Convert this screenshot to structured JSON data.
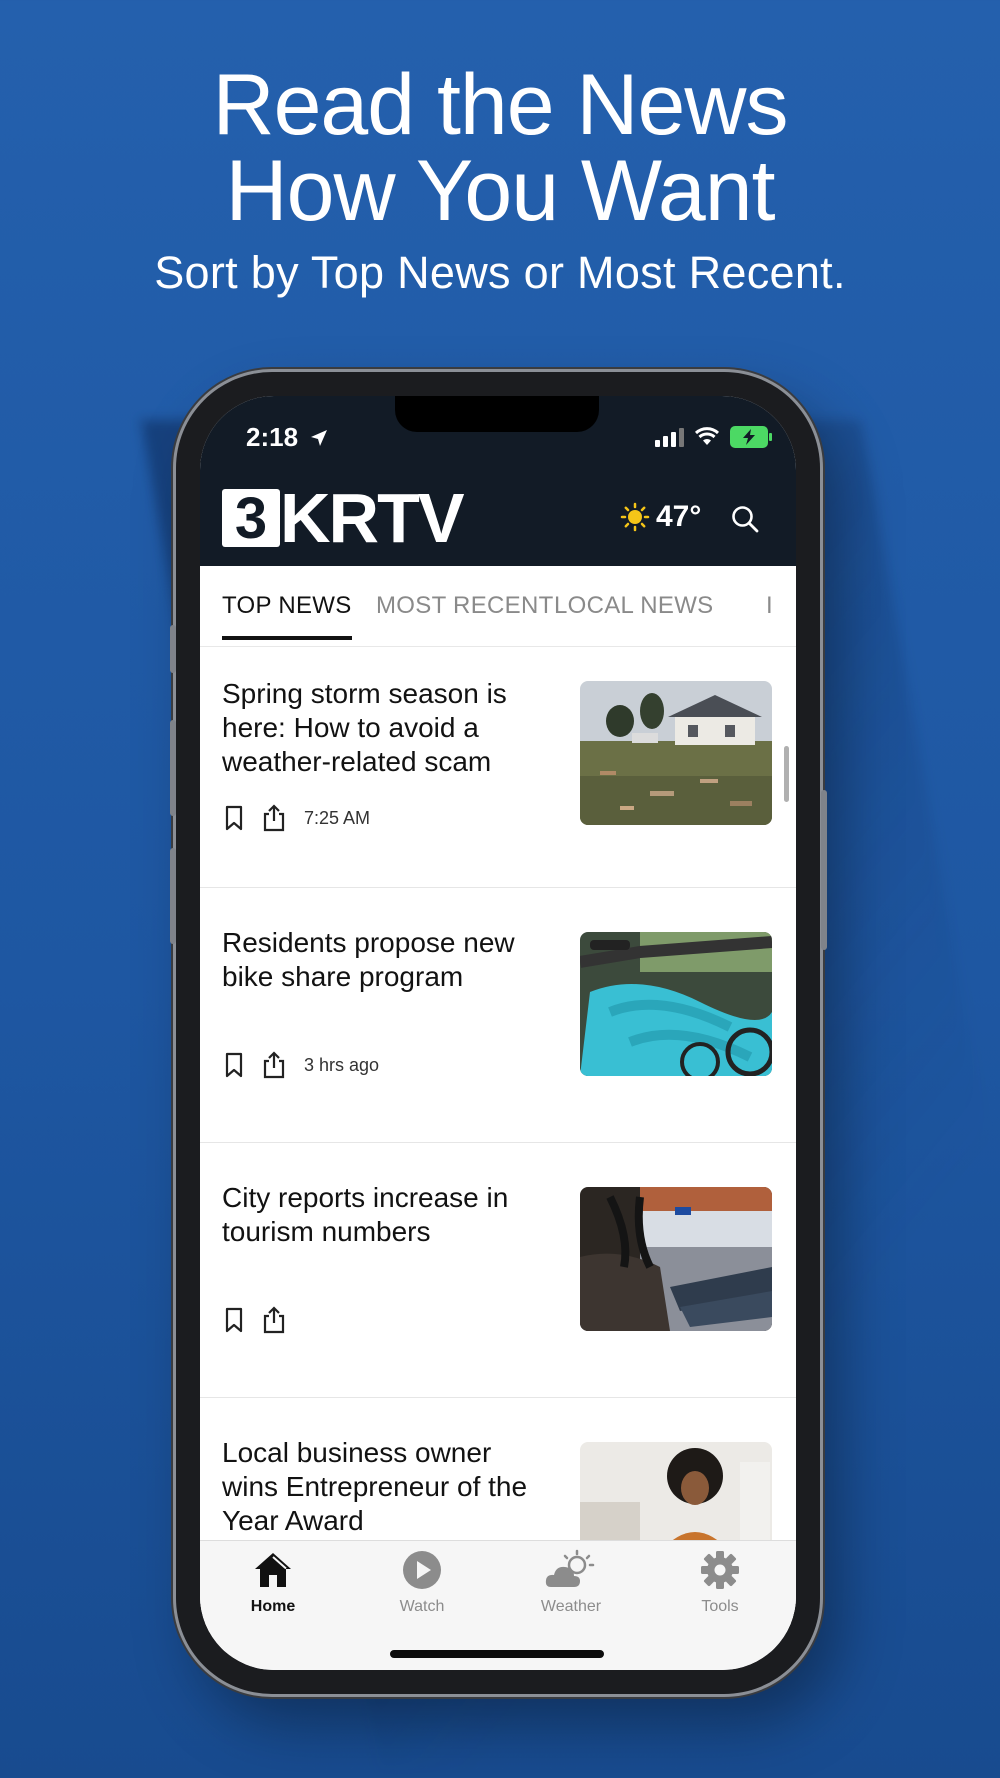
{
  "promo": {
    "headline_line1": "Read the News",
    "headline_line2": "How You Want",
    "subheadline": "Sort by Top News or Most Recent."
  },
  "status_bar": {
    "time": "2:18"
  },
  "header": {
    "logo_number": "3",
    "logo_text": "KRTV",
    "temperature": "47°",
    "weather_icon": "sun-icon",
    "search_icon": "search-icon"
  },
  "tabs": [
    {
      "label": "TOP NEWS",
      "active": true
    },
    {
      "label": "MOST RECENT",
      "active": false
    },
    {
      "label": "LOCAL NEWS",
      "active": false
    },
    {
      "label": "I",
      "active": false
    }
  ],
  "articles": [
    {
      "title": "Spring storm season is here: How to avoid a weather-related scam",
      "time": "7:25 AM",
      "image": "storm-damage-house"
    },
    {
      "title": "Residents propose new bike share program",
      "time": "3 hrs ago",
      "image": "bike-share-rack"
    },
    {
      "title": "City reports increase in tourism numbers",
      "time": "",
      "image": "airport-terminal"
    },
    {
      "title": "Local business owner wins Entrepreneur of the Year Award",
      "time": "",
      "image": "smiling-business-owner"
    }
  ],
  "bottom_nav": [
    {
      "label": "Home",
      "icon": "home-icon",
      "active": true
    },
    {
      "label": "Watch",
      "icon": "play-icon",
      "active": false
    },
    {
      "label": "Weather",
      "icon": "cloud-sun-icon",
      "active": false
    },
    {
      "label": "Tools",
      "icon": "gear-icon",
      "active": false
    }
  ],
  "colors": {
    "background": "#2460ad",
    "header_dark": "#121b26",
    "battery": "#4cd964",
    "sun": "#f5c518"
  }
}
